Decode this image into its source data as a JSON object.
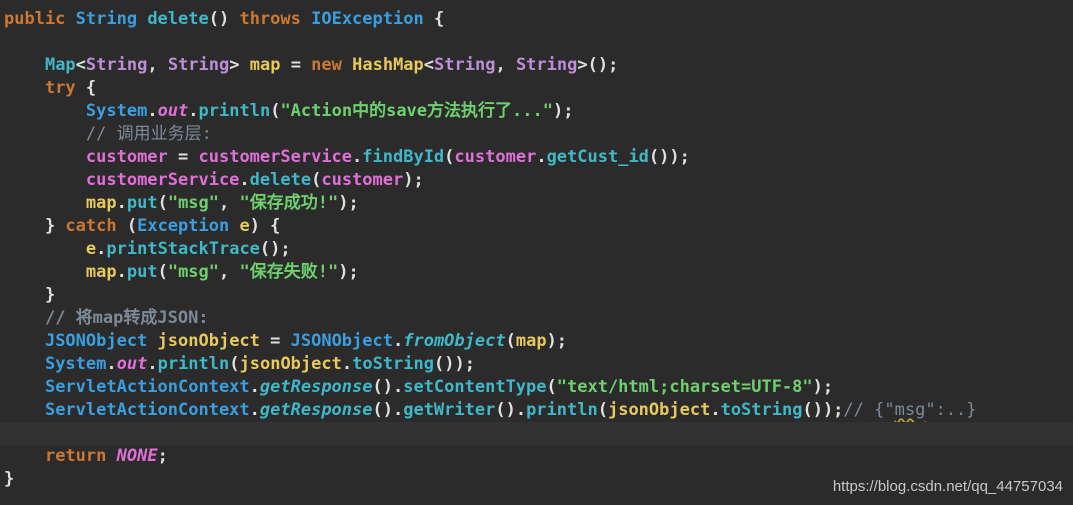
{
  "lines": [
    {
      "t": [
        {
          "c": "kw",
          "v": "public "
        },
        {
          "c": "typ",
          "v": "String "
        },
        {
          "c": "fn",
          "v": "delete"
        },
        {
          "c": "plain",
          "v": "() "
        },
        {
          "c": "kw",
          "v": "throws "
        },
        {
          "c": "typ",
          "v": "IOException "
        },
        {
          "c": "plain",
          "v": "{"
        }
      ]
    },
    {
      "t": []
    },
    {
      "t": [
        {
          "c": "plain",
          "v": "    "
        },
        {
          "c": "fn",
          "v": "Map"
        },
        {
          "c": "plain",
          "v": "<"
        },
        {
          "c": "cls",
          "v": "String"
        },
        {
          "c": "plain",
          "v": ", "
        },
        {
          "c": "cls",
          "v": "String"
        },
        {
          "c": "plain",
          "v": "> "
        },
        {
          "c": "var",
          "v": "map "
        },
        {
          "c": "plain",
          "v": "= "
        },
        {
          "c": "kw",
          "v": "new "
        },
        {
          "c": "var",
          "v": "HashMap"
        },
        {
          "c": "plain",
          "v": "<"
        },
        {
          "c": "cls",
          "v": "String"
        },
        {
          "c": "plain",
          "v": ", "
        },
        {
          "c": "cls",
          "v": "String"
        },
        {
          "c": "plain",
          "v": ">();"
        }
      ]
    },
    {
      "t": [
        {
          "c": "plain",
          "v": "    "
        },
        {
          "c": "kw",
          "v": "try "
        },
        {
          "c": "plain",
          "v": "{"
        }
      ]
    },
    {
      "t": [
        {
          "c": "plain",
          "v": "        "
        },
        {
          "c": "typ",
          "v": "System"
        },
        {
          "c": "plain",
          "v": "."
        },
        {
          "c": "fld it",
          "v": "out"
        },
        {
          "c": "plain",
          "v": "."
        },
        {
          "c": "call",
          "v": "println"
        },
        {
          "c": "plain",
          "v": "("
        },
        {
          "c": "str",
          "v": "\"Action中的save方法执行了...\""
        },
        {
          "c": "plain",
          "v": ");"
        }
      ]
    },
    {
      "t": [
        {
          "c": "plain",
          "v": "        "
        },
        {
          "c": "cm",
          "v": "// 调用业务层:"
        }
      ]
    },
    {
      "t": [
        {
          "c": "plain",
          "v": "        "
        },
        {
          "c": "fld",
          "v": "customer "
        },
        {
          "c": "plain",
          "v": "= "
        },
        {
          "c": "fld",
          "v": "customerService"
        },
        {
          "c": "plain",
          "v": "."
        },
        {
          "c": "call",
          "v": "findById"
        },
        {
          "c": "plain",
          "v": "("
        },
        {
          "c": "fld",
          "v": "customer"
        },
        {
          "c": "plain",
          "v": "."
        },
        {
          "c": "call",
          "v": "getCust_id"
        },
        {
          "c": "plain",
          "v": "());"
        }
      ]
    },
    {
      "t": [
        {
          "c": "plain",
          "v": "        "
        },
        {
          "c": "fld",
          "v": "customerService"
        },
        {
          "c": "plain",
          "v": "."
        },
        {
          "c": "call",
          "v": "delete"
        },
        {
          "c": "plain",
          "v": "("
        },
        {
          "c": "fld",
          "v": "customer"
        },
        {
          "c": "plain",
          "v": ");"
        }
      ]
    },
    {
      "t": [
        {
          "c": "plain",
          "v": "        "
        },
        {
          "c": "var",
          "v": "map"
        },
        {
          "c": "plain",
          "v": "."
        },
        {
          "c": "call",
          "v": "put"
        },
        {
          "c": "plain",
          "v": "("
        },
        {
          "c": "str",
          "v": "\"msg\""
        },
        {
          "c": "plain",
          "v": ", "
        },
        {
          "c": "str",
          "v": "\"保存成功!\""
        },
        {
          "c": "plain",
          "v": ");"
        }
      ]
    },
    {
      "t": [
        {
          "c": "plain",
          "v": "    } "
        },
        {
          "c": "kw",
          "v": "catch "
        },
        {
          "c": "plain",
          "v": "("
        },
        {
          "c": "typ",
          "v": "Exception "
        },
        {
          "c": "var",
          "v": "e"
        },
        {
          "c": "plain",
          "v": ") {"
        }
      ]
    },
    {
      "t": [
        {
          "c": "plain",
          "v": "        "
        },
        {
          "c": "var",
          "v": "e"
        },
        {
          "c": "plain",
          "v": "."
        },
        {
          "c": "call",
          "v": "printStackTrace"
        },
        {
          "c": "plain",
          "v": "();"
        }
      ]
    },
    {
      "t": [
        {
          "c": "plain",
          "v": "        "
        },
        {
          "c": "var",
          "v": "map"
        },
        {
          "c": "plain",
          "v": "."
        },
        {
          "c": "call",
          "v": "put"
        },
        {
          "c": "plain",
          "v": "("
        },
        {
          "c": "str",
          "v": "\"msg\""
        },
        {
          "c": "plain",
          "v": ", "
        },
        {
          "c": "str",
          "v": "\"保存失败!\""
        },
        {
          "c": "plain",
          "v": ");"
        }
      ]
    },
    {
      "t": [
        {
          "c": "plain",
          "v": "    }"
        }
      ]
    },
    {
      "t": [
        {
          "c": "plain",
          "v": "    "
        },
        {
          "c": "cmb",
          "v": "// 将map转成JSON:"
        }
      ]
    },
    {
      "t": [
        {
          "c": "plain",
          "v": "    "
        },
        {
          "c": "typ",
          "v": "JSONObject "
        },
        {
          "c": "var",
          "v": "jsonObject "
        },
        {
          "c": "plain",
          "v": "= "
        },
        {
          "c": "typ",
          "v": "JSONObject"
        },
        {
          "c": "plain",
          "v": "."
        },
        {
          "c": "fn it",
          "v": "fromObject"
        },
        {
          "c": "plain",
          "v": "("
        },
        {
          "c": "var",
          "v": "map"
        },
        {
          "c": "plain",
          "v": ");"
        }
      ]
    },
    {
      "t": [
        {
          "c": "plain",
          "v": "    "
        },
        {
          "c": "typ",
          "v": "System"
        },
        {
          "c": "plain",
          "v": "."
        },
        {
          "c": "fld it",
          "v": "out"
        },
        {
          "c": "plain",
          "v": "."
        },
        {
          "c": "call",
          "v": "println"
        },
        {
          "c": "plain",
          "v": "("
        },
        {
          "c": "var",
          "v": "jsonObject"
        },
        {
          "c": "plain",
          "v": "."
        },
        {
          "c": "call",
          "v": "toString"
        },
        {
          "c": "plain",
          "v": "());"
        }
      ]
    },
    {
      "t": [
        {
          "c": "plain",
          "v": "    "
        },
        {
          "c": "typ",
          "v": "ServletActionContext"
        },
        {
          "c": "plain",
          "v": "."
        },
        {
          "c": "fn it",
          "v": "getResponse"
        },
        {
          "c": "plain",
          "v": "()."
        },
        {
          "c": "call",
          "v": "setContentType"
        },
        {
          "c": "plain",
          "v": "("
        },
        {
          "c": "str",
          "v": "\"text/html;charset=UTF-8\""
        },
        {
          "c": "plain",
          "v": ");"
        }
      ]
    },
    {
      "t": [
        {
          "c": "plain",
          "v": "    "
        },
        {
          "c": "typ",
          "v": "ServletActionContext"
        },
        {
          "c": "plain",
          "v": "."
        },
        {
          "c": "fn it",
          "v": "getResponse"
        },
        {
          "c": "plain",
          "v": "()."
        },
        {
          "c": "call",
          "v": "getWriter"
        },
        {
          "c": "plain",
          "v": "()."
        },
        {
          "c": "call",
          "v": "println"
        },
        {
          "c": "plain",
          "v": "("
        },
        {
          "c": "var",
          "v": "jsonObject"
        },
        {
          "c": "plain",
          "v": "."
        },
        {
          "c": "call",
          "v": "toString"
        },
        {
          "c": "plain",
          "v": "());"
        },
        {
          "c": "cm",
          "v": "// {\""
        },
        {
          "c": "cm sq",
          "v": "msg"
        },
        {
          "c": "cm",
          "v": "\":..}"
        }
      ]
    },
    {
      "t": [],
      "current": true
    },
    {
      "t": [
        {
          "c": "plain",
          "v": "    "
        },
        {
          "c": "kw",
          "v": "return "
        },
        {
          "c": "fld it",
          "v": "NONE"
        },
        {
          "c": "plain",
          "v": ";"
        }
      ]
    },
    {
      "t": [
        {
          "c": "plain",
          "v": "}"
        }
      ]
    }
  ],
  "watermark": "https://blog.csdn.net/qq_44757034"
}
